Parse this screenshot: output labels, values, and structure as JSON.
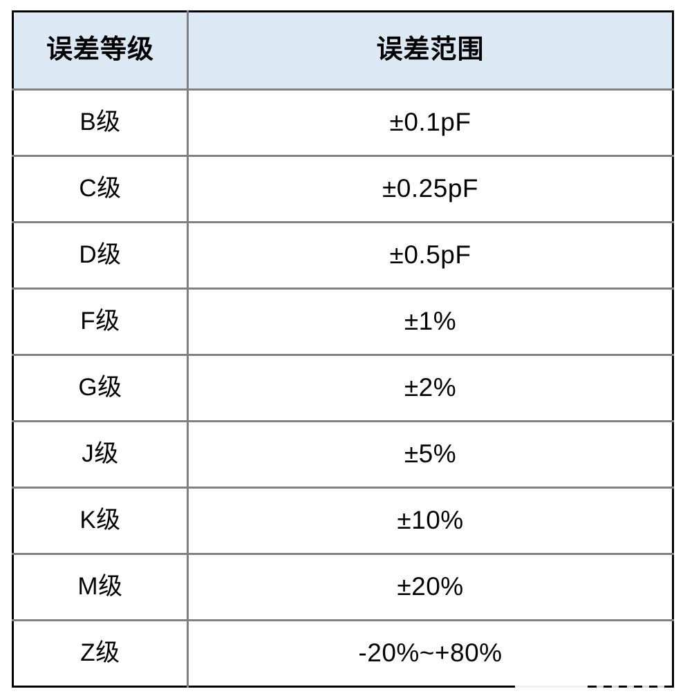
{
  "table": {
    "name": "capacitor-tolerance-table",
    "colors": {
      "header_background": "#dce8f4",
      "outer_border": "#000000",
      "inner_border": "#808080",
      "text": "#000000",
      "page_background": "#ffffff"
    },
    "headers": [
      {
        "key": "grade",
        "label": "误差等级"
      },
      {
        "key": "range",
        "label": "误差范围"
      }
    ],
    "rows": [
      {
        "grade": "B级",
        "range": "±0.1pF"
      },
      {
        "grade": "C级",
        "range": "±0.25pF"
      },
      {
        "grade": "D级",
        "range": "±0.5pF"
      },
      {
        "grade": "F级",
        "range": "±1%"
      },
      {
        "grade": "G级",
        "range": "±2%"
      },
      {
        "grade": "J级",
        "range": "±5%"
      },
      {
        "grade": "K级",
        "range": "±10%"
      },
      {
        "grade": "M级",
        "range": "±20%"
      },
      {
        "grade": "Z级",
        "range": "-20%~+80%"
      }
    ]
  }
}
